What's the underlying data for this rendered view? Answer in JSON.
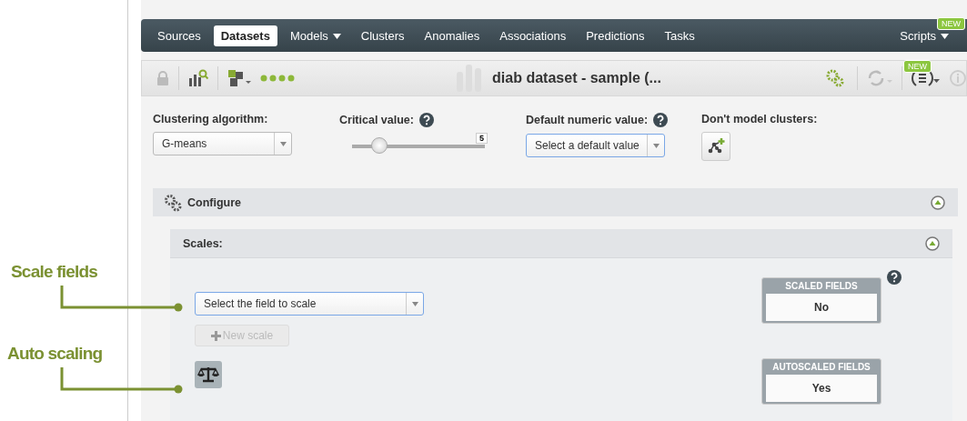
{
  "nav": {
    "tabs": [
      {
        "label": "Sources",
        "selected": false,
        "dropdown": false
      },
      {
        "label": "Datasets",
        "selected": true,
        "dropdown": false
      },
      {
        "label": "Models",
        "selected": false,
        "dropdown": true
      },
      {
        "label": "Clusters",
        "selected": false,
        "dropdown": false
      },
      {
        "label": "Anomalies",
        "selected": false,
        "dropdown": false
      },
      {
        "label": "Associations",
        "selected": false,
        "dropdown": false
      },
      {
        "label": "Predictions",
        "selected": false,
        "dropdown": false
      },
      {
        "label": "Tasks",
        "selected": false,
        "dropdown": false
      }
    ],
    "scripts": {
      "label": "Scripts",
      "badge": "NEW"
    }
  },
  "toolbar": {
    "title": "diab dataset - sample (...",
    "badge": "NEW"
  },
  "params": {
    "algorithm": {
      "label": "Clustering algorithm:",
      "value": "G-means"
    },
    "critical": {
      "label": "Critical value:",
      "reading": "5",
      "level": 0.21
    },
    "default_numeric": {
      "label": "Default numeric value:",
      "placeholder": "Select a default value"
    },
    "dont_model": {
      "label": "Don't model clusters:"
    }
  },
  "configure": {
    "title": "Configure",
    "expanded": true
  },
  "scales": {
    "title": "Scales:",
    "expanded": true,
    "field_placeholder": "Select the field to scale",
    "new_scale": "New scale",
    "scaled": {
      "label": "SCALED FIELDS",
      "value": "No"
    },
    "autoscaled": {
      "label": "AUTOSCALED FIELDS",
      "value": "Yes"
    }
  },
  "callouts": [
    "Scale fields",
    "Auto scaling"
  ]
}
